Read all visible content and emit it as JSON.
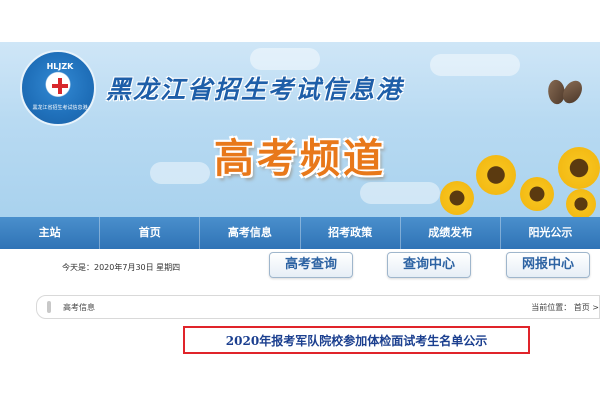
{
  "header": {
    "logo_top_text": "HLJZK",
    "logo_bottom_text": "黑龙江省招生考试信息港",
    "site_title": "黑龙江省招生考试信息港",
    "channel_title": "高考频道"
  },
  "nav": {
    "items": [
      {
        "label": "主站"
      },
      {
        "label": "首页"
      },
      {
        "label": "高考信息"
      },
      {
        "label": "招考政策"
      },
      {
        "label": "成绩发布"
      },
      {
        "label": "阳光公示"
      }
    ]
  },
  "info": {
    "date_text": "今天是：2020年7月30日 星期四"
  },
  "quick_buttons": {
    "gaokao_query": "高考查询",
    "query_center": "查询中心",
    "online_signup_center": "网报中心"
  },
  "breadcrumb": {
    "section": "高考信息",
    "location_label": "当前位置：",
    "home": "首页",
    "separator": ">"
  },
  "notice": {
    "title": "2020年报考军队院校参加体检面试考生名单公示"
  },
  "colors": {
    "nav_bg": "#2f73b6",
    "channel_title": "#e8781a",
    "notice_title": "#1b3f8f",
    "highlight_border": "#e0242a"
  }
}
